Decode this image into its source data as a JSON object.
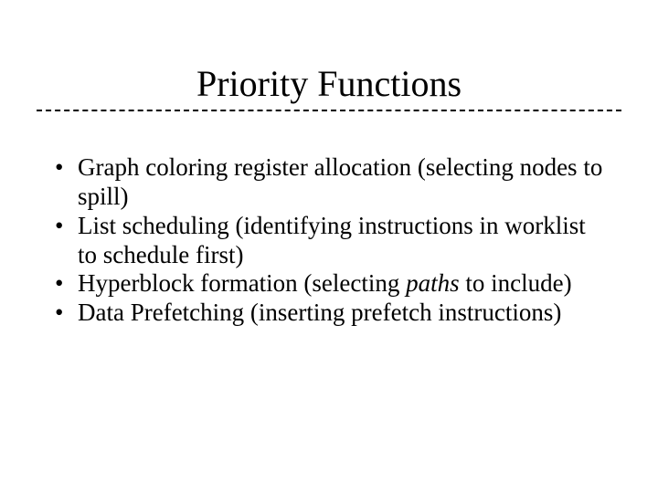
{
  "title": "Priority Functions",
  "bullets": {
    "b0_a": "Graph coloring register allocation (selecting nodes to spill)",
    "b1_a": "List scheduling (identifying instructions in worklist to schedule first)",
    "b2_a": "Hyperblock formation (selecting ",
    "b2_i": "paths",
    "b2_b": " to include)",
    "b3_a": "Data Prefetching (inserting prefetch instructions)"
  }
}
